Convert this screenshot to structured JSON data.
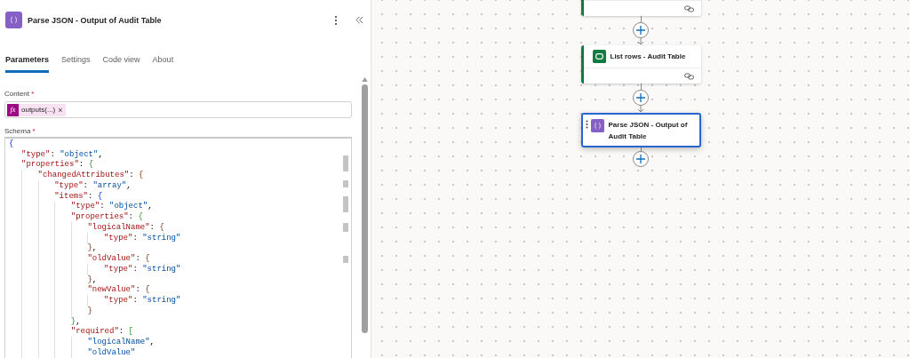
{
  "panel": {
    "title": "Parse JSON - Output of Audit Table",
    "tabs": [
      {
        "label": "Parameters",
        "selected": true
      },
      {
        "label": "Settings",
        "selected": false
      },
      {
        "label": "Code view",
        "selected": false
      },
      {
        "label": "About",
        "selected": false
      }
    ],
    "content": {
      "label": "Content",
      "required_mark": "*",
      "token": {
        "icon": "fx",
        "text": "outputs(...)",
        "remove": "×"
      }
    },
    "schema": {
      "label": "Schema",
      "required_mark": "*",
      "lines": [
        {
          "text": "{",
          "children": [
            {
              "text": "\"type\": \"object\","
            },
            {
              "text": "\"properties\": {",
              "children": [
                {
                  "text": "\"changedAttributes\": {",
                  "children": [
                    {
                      "text": "\"type\": \"array\","
                    },
                    {
                      "text": "\"items\": {",
                      "children": [
                        {
                          "text": "\"type\": \"object\","
                        },
                        {
                          "text": "\"properties\": {",
                          "children": [
                            {
                              "text": "\"logicalName\": {",
                              "children": [
                                {
                                  "text": "\"type\": \"string\""
                                }
                              ]
                            },
                            {
                              "text": "},"
                            },
                            {
                              "text": "\"oldValue\": {",
                              "children": [
                                {
                                  "text": "\"type\": \"string\""
                                }
                              ]
                            },
                            {
                              "text": "},"
                            },
                            {
                              "text": "\"newValue\": {",
                              "children": [
                                {
                                  "text": "\"type\": \"string\""
                                }
                              ]
                            },
                            {
                              "text": "}"
                            }
                          ]
                        },
                        {
                          "text": "},"
                        },
                        {
                          "text": "\"required\": [",
                          "children": [
                            {
                              "text": "\"logicalName\","
                            },
                            {
                              "text": "\"oldValue\""
                            }
                          ]
                        }
                      ]
                    }
                  ]
                }
              ]
            }
          ]
        }
      ]
    }
  },
  "canvas": {
    "nodes": [
      {
        "kind": "partial",
        "color": "#107c41",
        "selected": false,
        "link": true
      },
      {
        "kind": "dataverse",
        "title": "List rows - Audit Table",
        "color": "#107c41",
        "selected": false,
        "link": true
      },
      {
        "kind": "parse",
        "title": "Parse JSON - Output of Audit Table",
        "selected": true,
        "link": false
      }
    ]
  }
}
